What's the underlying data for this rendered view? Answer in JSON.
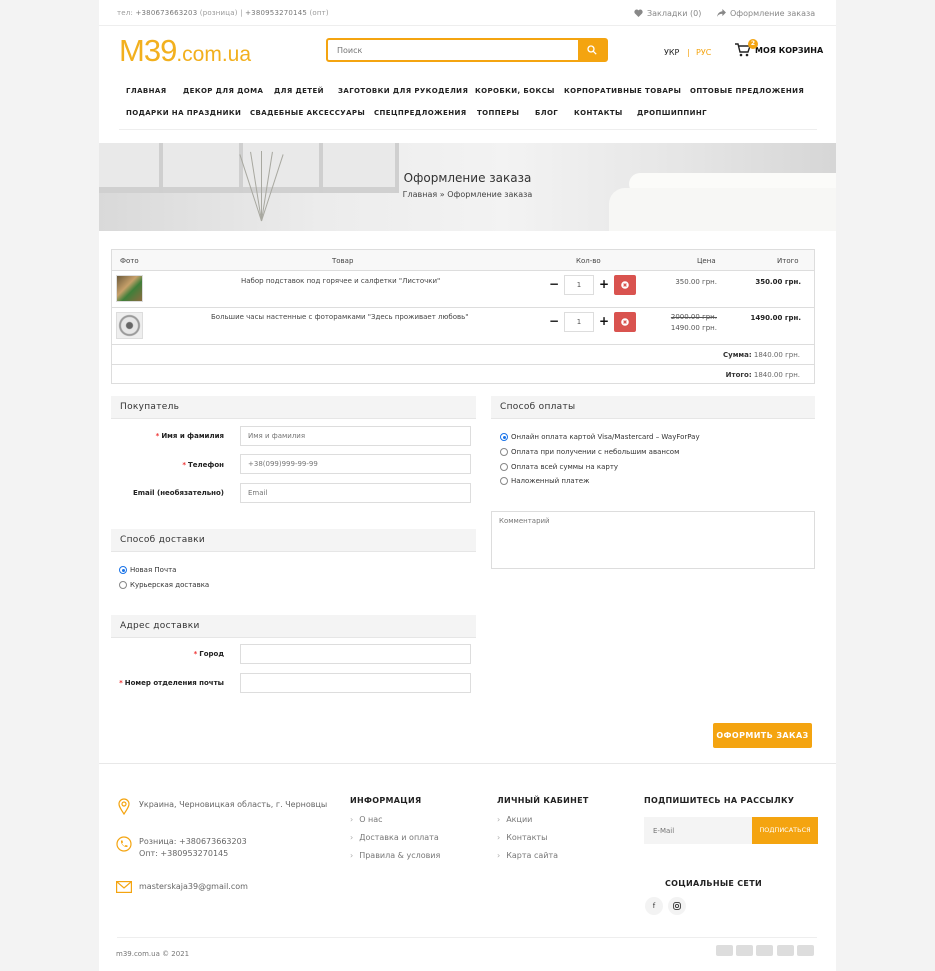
{
  "topbar": {
    "phones_prefix": "тел: ",
    "retail_phone": "+380673663203",
    "retail_label": " (розница) | ",
    "wholesale_phone": "+380953270145",
    "wholesale_label": " (опт)",
    "bookmarks": "Закладки (0)",
    "checkout_link": "Оформление заказа"
  },
  "header": {
    "logo_main": "M39",
    "logo_domain": ".com.ua",
    "search_placeholder": "Поиск",
    "lang_ukr": "УКР",
    "lang_sep": "|",
    "lang_rus": "РУС",
    "cart_label": "МОЯ КОРЗИНА",
    "cart_count": "2"
  },
  "nav": {
    "row1": [
      "ГЛАВНАЯ",
      "ДЕКОР ДЛЯ ДОМА",
      "ДЛЯ ДЕТЕЙ",
      "ЗАГОТОВКИ ДЛЯ РУКОДЕЛИЯ",
      "КОРОБКИ, БОКСЫ",
      "КОРПОРАТИВНЫЕ ТОВАРЫ",
      "ОПТОВЫЕ ПРЕДЛОЖЕНИЯ"
    ],
    "row2": [
      "ПОДАРКИ НА ПРАЗДНИКИ",
      "СВАДЕБНЫЕ АКСЕССУАРЫ",
      "СПЕЦПРЕДЛОЖЕНИЯ",
      "ТОППЕРЫ",
      "БЛОГ",
      "КОНТАКТЫ",
      "ДРОПШИППИНГ"
    ]
  },
  "banner": {
    "title": "Оформление заказа",
    "crumb_home": "Главная",
    "crumb_sep": " » ",
    "crumb_current": "Оформление заказа"
  },
  "cart_table": {
    "headers": {
      "photo": "Фото",
      "product": "Товар",
      "qty": "Кол-во",
      "price": "Цена",
      "total": "Итого"
    },
    "rows": [
      {
        "name": "Набор подставок под горячее и салфетки \"Листочки\"",
        "qty": "1",
        "price": "350.00 грн.",
        "old_price": "",
        "total": "350.00 грн."
      },
      {
        "name": "Большие часы настенные с фоторамками \"Здесь проживает любовь\"",
        "qty": "1",
        "price": "1490.00 грн.",
        "old_price": "2000.00 грн.",
        "total": "1490.00 грн."
      }
    ],
    "sum_label": "Сумма:",
    "sum_value": " 1840.00 грн.",
    "grand_label": "Итого:",
    "grand_value": " 1840.00 грн."
  },
  "buyer": {
    "title": "Покупатель",
    "name_label": "Имя и фамилия",
    "name_placeholder": "Имя и фамилия",
    "phone_label": "Телефон",
    "phone_placeholder": "+38(099)999-99-99",
    "email_label": "Email (необязательно)",
    "email_placeholder": "Email",
    "required_mark": "*"
  },
  "delivery": {
    "title": "Способ доставки",
    "options": [
      "Новая Почта",
      "Курьерская доставка"
    ]
  },
  "address": {
    "title": "Адрес доставки",
    "city_label": "Город",
    "office_label": "Номер отделения почты"
  },
  "payment": {
    "title": "Способ оплаты",
    "options": [
      "Онлайн оплата картой Visa/Mastercard – WayForPay",
      "Оплата при получении с небольшим авансом",
      "Оплата всей суммы на карту",
      "Наложенный платеж"
    ]
  },
  "comment_placeholder": "Комментарий",
  "order_button": "ОФОРМИТЬ ЗАКАЗ",
  "footer": {
    "address": "Украина, Черновицкая область, г. Черновцы",
    "retail": "Розница: +380673663203",
    "wholesale": "Опт: +380953270145",
    "email": "masterskaja39@gmail.com",
    "info_title": "ИНФОРМАЦИЯ",
    "info_links": [
      "О нас",
      "Доставка и оплата",
      "Правила & условия"
    ],
    "account_title": "ЛИЧНЫЙ КАБИНЕТ",
    "account_links": [
      "Акции",
      "Контакты",
      "Карта сайта"
    ],
    "subscribe_title": "ПОДПИШИТЕСЬ НА РАССЫЛКУ",
    "subscribe_placeholder": "E-Mail",
    "subscribe_button": "ПОДПИСАТЬСЯ",
    "social_title": "СОЦИАЛЬНЫЕ СЕТИ",
    "social_facebook": "f",
    "copyright": "m39.com.ua © 2021"
  },
  "colors": {
    "accent": "#f4a410",
    "danger": "#d9534f",
    "radio": "#1a73e8"
  }
}
